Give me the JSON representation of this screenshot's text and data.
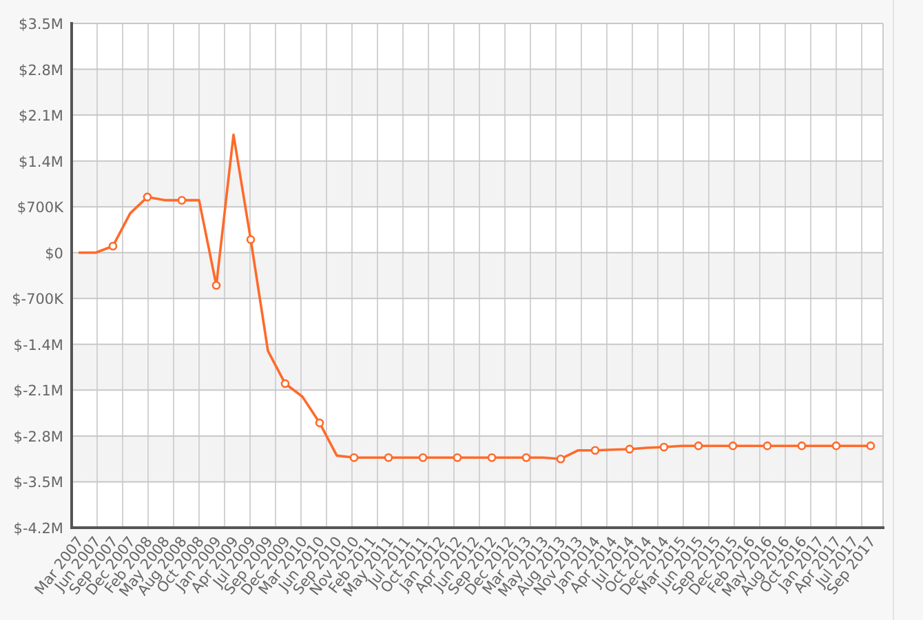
{
  "chart_data": {
    "type": "line",
    "x": [
      "Mar 2007",
      "Jun 2007",
      "Sep 2007",
      "Dec 2007",
      "Feb 2008",
      "May 2008",
      "Aug 2008",
      "Oct 2008",
      "Jan 2009",
      "Apr 2009",
      "Jul 2009",
      "Sep 2009",
      "Dec 2009",
      "Mar 2010",
      "Jun 2010",
      "Sep 2010",
      "Nov 2010",
      "Feb 2011",
      "May 2011",
      "Jul 2011",
      "Oct 2011",
      "Jan 2012",
      "Apr 2012",
      "Jun 2012",
      "Sep 2012",
      "Dec 2012",
      "Mar 2013",
      "May 2013",
      "Aug 2013",
      "Nov 2013",
      "Jan 2014",
      "Apr 2014",
      "Jul 2014",
      "Oct 2014",
      "Dec 2014",
      "Mar 2015",
      "Jun 2015",
      "Sep 2015",
      "Dec 2015",
      "Feb 2016",
      "May 2016",
      "Aug 2016",
      "Oct 2016",
      "Jan 2017",
      "Apr 2017",
      "Jul 2017",
      "Sep 2017"
    ],
    "grid": true,
    "values": [
      0,
      0,
      100000,
      600000,
      850000,
      800000,
      800000,
      800000,
      -500000,
      1800000,
      200000,
      -1500000,
      -2000000,
      -2200000,
      -2600000,
      -3100000,
      -3130000,
      -3130000,
      -3130000,
      -3130000,
      -3130000,
      -3130000,
      -3130000,
      -3130000,
      -3130000,
      -3130000,
      -3130000,
      -3130000,
      -3150000,
      -3020000,
      -3020000,
      -3010000,
      -3000000,
      -2980000,
      -2970000,
      -2950000,
      -2950000,
      -2950000,
      -2950000,
      -2950000,
      -2950000,
      -2950000,
      -2950000,
      -2950000,
      -2950000,
      -2950000,
      -2950000
    ],
    "ylim": [
      -4200000,
      3500000
    ],
    "yticks": [
      {
        "value": 3500000,
        "label": "$3.5M"
      },
      {
        "value": 2800000,
        "label": "$2.8M"
      },
      {
        "value": 2100000,
        "label": "$2.1M"
      },
      {
        "value": 1400000,
        "label": "$1.4M"
      },
      {
        "value": 700000,
        "label": "$700K"
      },
      {
        "value": 0,
        "label": "$0"
      },
      {
        "value": -700000,
        "label": "$-700K"
      },
      {
        "value": -1400000,
        "label": "$-1.4M"
      },
      {
        "value": -2100000,
        "label": "$-2.1M"
      },
      {
        "value": -2800000,
        "label": "$-2.8M"
      },
      {
        "value": -3500000,
        "label": "$-3.5M"
      },
      {
        "value": -4200000,
        "label": "$-4.2M"
      }
    ]
  }
}
